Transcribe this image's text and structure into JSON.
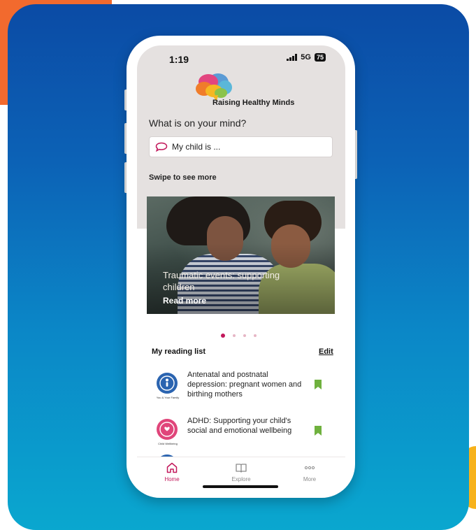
{
  "status_bar": {
    "time": "1:19",
    "network": "5G",
    "battery": "75"
  },
  "brand": {
    "name": "Raising Healthy Minds"
  },
  "search": {
    "question": "What is on your mind?",
    "placeholder": "My child is ..."
  },
  "carousel": {
    "hint": "Swipe to see more",
    "card": {
      "title": "Traumatic events: supporting children",
      "link": "Read more"
    },
    "page_count": 4,
    "active_index": 0
  },
  "reading_list": {
    "title": "My reading list",
    "edit_label": "Edit",
    "items": [
      {
        "title": "Antenatal and postnatal depression: pregnant women and birthing mothers",
        "category": "You & Your Family",
        "color": "#2b64b0"
      },
      {
        "title": "ADHD: Supporting your child's social and emotional wellbeing",
        "category": "Child Wellbeing",
        "color": "#e0457a"
      }
    ]
  },
  "tabs": [
    {
      "label": "Home",
      "icon": "home-icon",
      "active": true
    },
    {
      "label": "Explore",
      "icon": "book-icon",
      "active": false
    },
    {
      "label": "More",
      "icon": "more-icon",
      "active": false
    }
  ],
  "colors": {
    "accent": "#c2185b",
    "bookmark": "#6fb13e",
    "top_bg": "#e5e1e0"
  }
}
